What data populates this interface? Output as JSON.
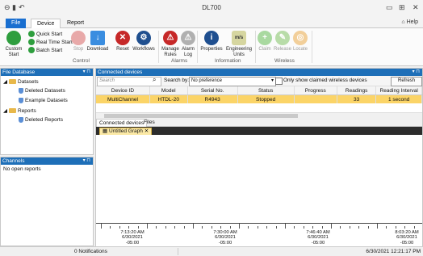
{
  "window": {
    "title": "DL700"
  },
  "tabs": [
    "File",
    "Device",
    "Report"
  ],
  "help": "Help",
  "ribbon": {
    "custom_start": "Custom Start",
    "quick_start": "Quick Start",
    "real_time_start": "Real Time Start",
    "batch_start": "Batch Start",
    "stop": "Stop",
    "download": "Download",
    "reset": "Reset",
    "workflows": "Workflows",
    "manage_rules": "Manage Rules",
    "alarm_log": "Alarm Log",
    "properties": "Properties",
    "engineering_units": "Engineering Units",
    "claim": "Claim",
    "release": "Release",
    "locate": "Locate",
    "groups": {
      "control": "Control",
      "alarms": "Alarms",
      "information": "Information",
      "wireless": "Wireless"
    }
  },
  "file_database": {
    "header": "File Database",
    "items": [
      "Datasets",
      "Deleted Datasets",
      "Example Datasets",
      "Reports",
      "Deleted Reports"
    ]
  },
  "channels": {
    "header": "Channels",
    "empty": "No open reports"
  },
  "connected": {
    "header": "Connected devices",
    "search_placeholder": "Search",
    "search_by_label": "Search by:",
    "search_by_value": "No preference",
    "only_wireless": "Only show claimed wireless devices",
    "refresh": "Refresh",
    "columns": [
      "Device ID",
      "Model",
      "Serial No.",
      "Status",
      "Progress",
      "Readings",
      "Reading Interval"
    ],
    "rows": [
      [
        "MultiChannel",
        "HTDL-20",
        "R4943",
        "Stopped",
        "",
        "33",
        "1 second"
      ]
    ]
  },
  "subtabs": [
    "Connected devices",
    "Files"
  ],
  "graph": {
    "tab": "Untitled Graph",
    "times": [
      {
        "t": "7:13:20 AM",
        "d": "6/30/2021",
        "z": "-05:00"
      },
      {
        "t": "7:30:00 AM",
        "d": "6/30/2021",
        "z": "-05:00"
      },
      {
        "t": "7:46:40 AM",
        "d": "6/30/2021",
        "z": "-05:00"
      },
      {
        "t": "8:03:20 AM",
        "d": "6/30/2021",
        "z": "-05:00"
      }
    ]
  },
  "status": {
    "notifications": "0 Notifications",
    "datetime": "6/30/2021 12:21:17 PM"
  }
}
